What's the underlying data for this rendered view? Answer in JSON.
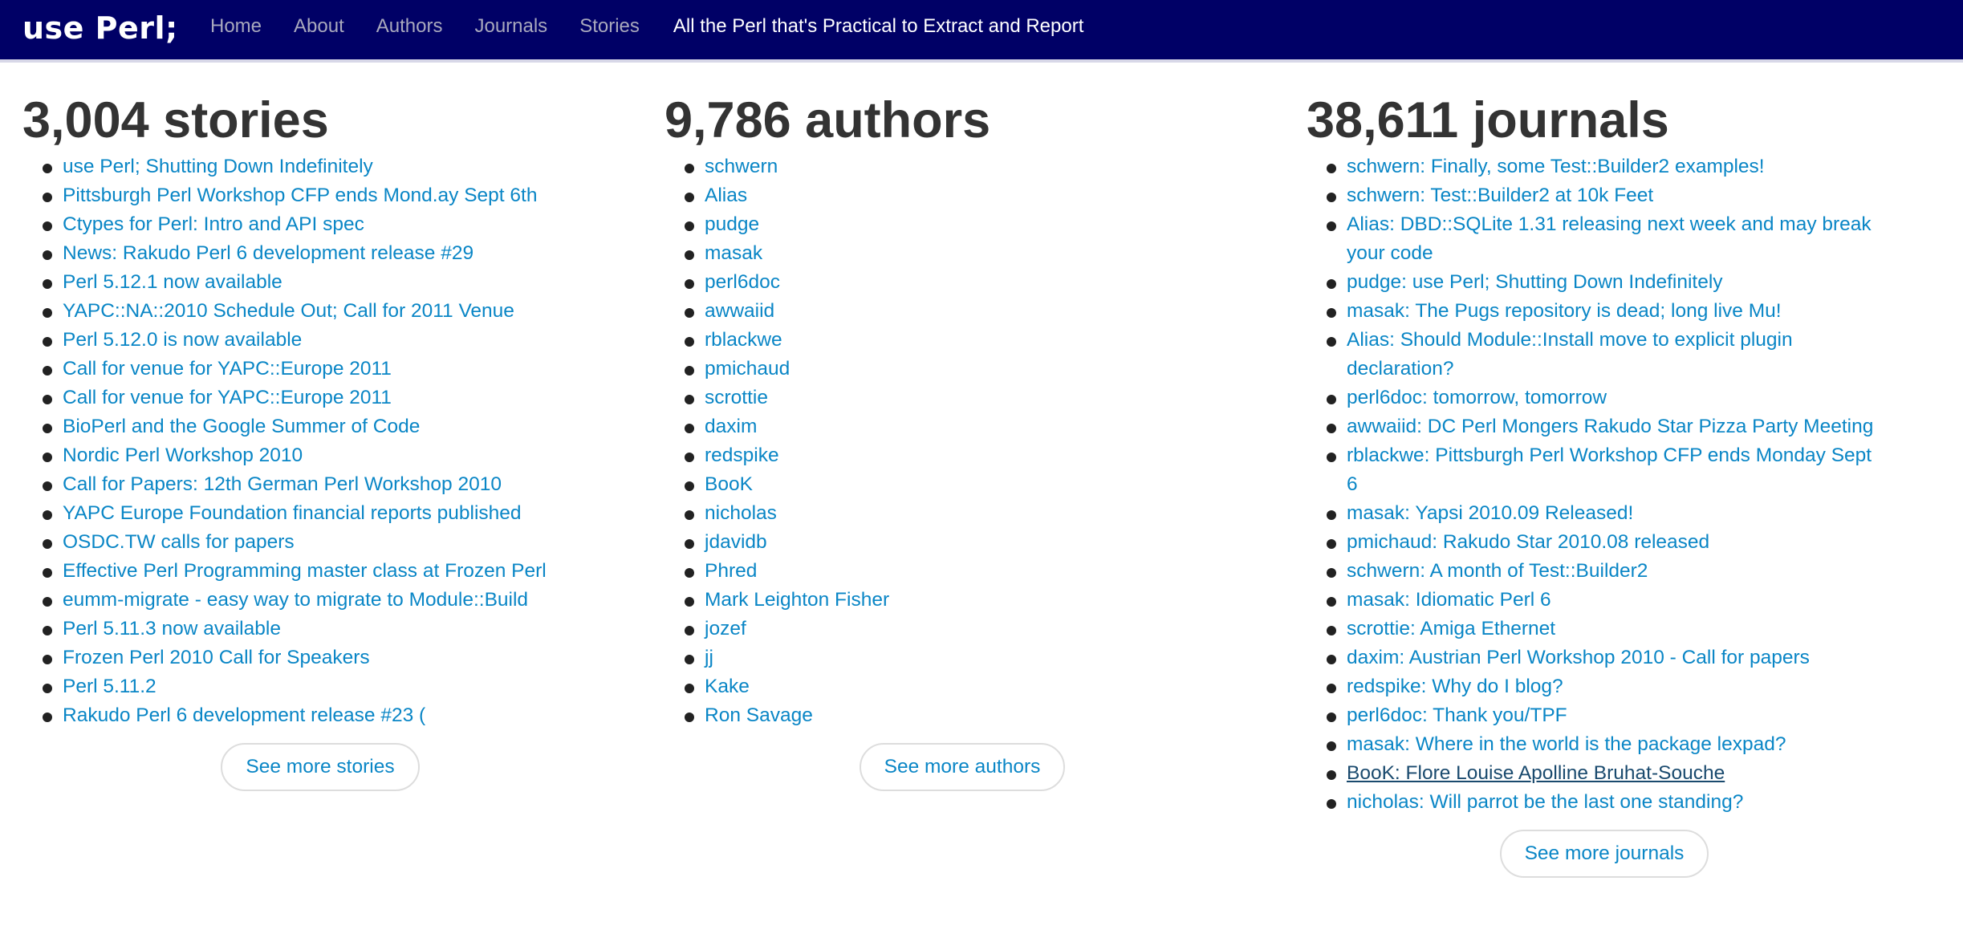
{
  "nav": {
    "brand": "use Perl;",
    "links": [
      "Home",
      "About",
      "Authors",
      "Journals",
      "Stories"
    ],
    "tagline": "All the Perl that's Practical to Extract and Report"
  },
  "stories": {
    "heading": "3,004 stories",
    "items": [
      "use Perl; Shutting Down Indefinitely",
      "Pittsburgh Perl Workshop CFP ends Mond.ay Sept 6th",
      "Ctypes for Perl: Intro and API spec",
      "News: Rakudo Perl 6 development release #29",
      "Perl 5.12.1 now available",
      "YAPC::NA::2010 Schedule Out; Call for 2011 Venue",
      "Perl 5.12.0 is now available",
      "Call for venue for YAPC::Europe 2011",
      "Call for venue for YAPC::Europe 2011",
      "BioPerl and the Google Summer of Code",
      "Nordic Perl Workshop 2010",
      "Call for Papers: 12th German Perl Workshop 2010",
      "YAPC Europe Foundation financial reports published",
      "OSDC.TW calls for papers",
      "Effective Perl Programming master class at Frozen Perl",
      "eumm-migrate - easy way to migrate to Module::Build",
      "Perl 5.11.3 now available",
      "Frozen Perl 2010 Call for Speakers",
      "Perl 5.11.2",
      "Rakudo Perl 6 development release #23 ("
    ],
    "more_label": "See more stories"
  },
  "authors": {
    "heading": "9,786 authors",
    "items": [
      "schwern",
      "Alias",
      "pudge",
      "masak",
      "perl6doc",
      "awwaiid",
      "rblackwe",
      "pmichaud",
      "scrottie",
      "daxim",
      "redspike",
      "BooK",
      "nicholas",
      "jdavidb",
      "Phred",
      "Mark Leighton Fisher",
      "jozef",
      "jj",
      "Kake",
      "Ron Savage"
    ],
    "more_label": "See more authors"
  },
  "journals": {
    "heading": "38,611 journals",
    "items": [
      "schwern: Finally, some Test::Builder2 examples!",
      "schwern: Test::Builder2 at 10k Feet",
      "Alias: DBD::SQLite 1.31 releasing next week and may break your code",
      "pudge: use Perl; Shutting Down Indefinitely",
      "masak: The Pugs repository is dead; long live Mu!",
      "Alias: Should Module::Install move to explicit plugin declaration?",
      "perl6doc: tomorrow, tomorrow",
      "awwaiid: DC Perl Mongers Rakudo Star Pizza Party Meeting",
      "rblackwe: Pittsburgh Perl Workshop CFP ends Monday Sept 6",
      "masak: Yapsi 2010.09 Released!",
      "pmichaud: Rakudo Star 2010.08 released",
      "schwern: A month of Test::Builder2",
      "masak: Idiomatic Perl 6",
      "scrottie: Amiga Ethernet",
      "daxim: Austrian Perl Workshop 2010 - Call for papers",
      "redspike: Why do I blog?",
      "perl6doc: Thank you/TPF",
      "masak: Where in the world is the package lexpad?",
      "BooK: Flore Louise Apolline Bruhat-Souche",
      "nicholas: Will parrot be the last one standing?"
    ],
    "hovered_index": 18,
    "more_label": "See more journals"
  },
  "colors": {
    "navbar": "#000066",
    "link": "#0a86c6",
    "heading": "#333333"
  }
}
